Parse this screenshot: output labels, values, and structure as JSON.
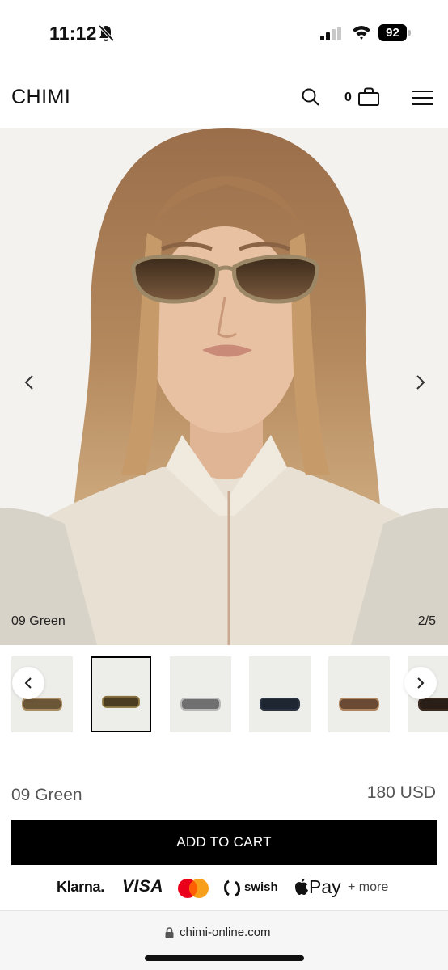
{
  "status": {
    "time": "11:12",
    "battery": "92"
  },
  "header": {
    "brand": "CHIMI",
    "cart_count": "0"
  },
  "hero": {
    "variant": "09 Green",
    "slide_counter": "2/5"
  },
  "thumbnails": [
    {
      "lens": "#6b5637",
      "frame": "#a98d63"
    },
    {
      "lens": "#4a3d22",
      "frame": "#8a7440"
    },
    {
      "lens": "#6f6f6f",
      "frame": "#b9b9b9"
    },
    {
      "lens": "#1d2631",
      "frame": "#2b3440"
    },
    {
      "lens": "#6a4a34",
      "frame": "#b08661"
    },
    {
      "lens": "#2a1f18",
      "frame": "#3c2b20"
    }
  ],
  "product": {
    "name": "09 Green",
    "price": "180 USD",
    "cta": "ADD TO CART"
  },
  "payments": {
    "klarna": "Klarna.",
    "visa": "VISA",
    "swish": "swish",
    "apple_pay": "Pay",
    "more": "+ more"
  },
  "browser": {
    "url": "chimi-online.com"
  },
  "colors": {
    "cta_bg": "#000000",
    "hero_bg": "#f3f2ef",
    "thumb_bg": "#ededea"
  }
}
